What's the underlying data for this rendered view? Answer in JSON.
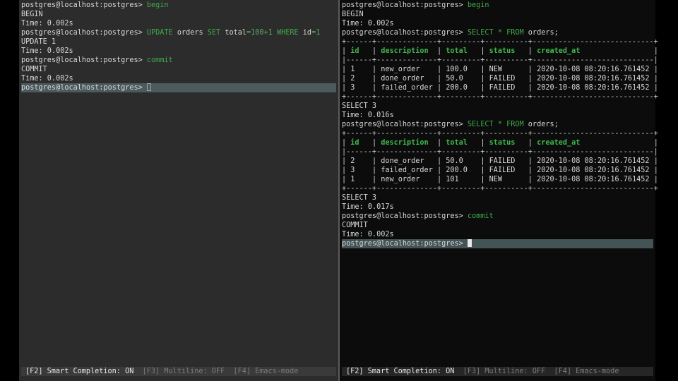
{
  "left": {
    "lines": [
      {
        "prompt": "postgres@localhost:postgres> ",
        "cmd": "begin"
      },
      {
        "out": "BEGIN"
      },
      {
        "out": "Time: 0.002s"
      },
      {
        "prompt": "postgres@localhost:postgres> ",
        "cmd": "UPDATE orders SET total=100+1 WHERE id=1"
      },
      {
        "out": "UPDATE 1"
      },
      {
        "out": "Time: 0.002s"
      },
      {
        "prompt": "postgres@localhost:postgres> ",
        "cmd": "commit"
      },
      {
        "out": "COMMIT"
      },
      {
        "out": "Time: 0.002s"
      },
      {
        "prompt": "postgres@localhost:postgres> ",
        "current": true
      }
    ],
    "toolbar": {
      "f2": "[F2] Smart Completion: ON",
      "f3": "[F3] Multiline: OFF",
      "f4": "[F4] Emacs-mode"
    }
  },
  "right": {
    "lines": [
      {
        "prompt": "postgres@localhost:postgres> ",
        "cmd": "begin"
      },
      {
        "out": "BEGIN"
      },
      {
        "out": "Time: 0.002s"
      },
      {
        "prompt": "postgres@localhost:postgres> ",
        "cmd": "SELECT * FROM orders;"
      },
      {
        "table": 1
      },
      {
        "out": "SELECT 3"
      },
      {
        "out": "Time: 0.016s"
      },
      {
        "prompt": "postgres@localhost:postgres> ",
        "cmd": "SELECT * FROM orders;"
      },
      {
        "table": 2
      },
      {
        "out": "SELECT 3"
      },
      {
        "out": "Time: 0.017s"
      },
      {
        "prompt": "postgres@localhost:postgres> ",
        "cmd": "commit"
      },
      {
        "out": "COMMIT"
      },
      {
        "out": "Time: 0.002s"
      },
      {
        "prompt": "postgres@localhost:postgres> ",
        "current": true
      }
    ],
    "tables": {
      "columns": [
        "id",
        "description",
        "total",
        "status",
        "created_at"
      ],
      "t1": [
        [
          "1",
          "new_order",
          "100.0",
          "NEW",
          "2020-10-08 08:20:16.761452"
        ],
        [
          "2",
          "done_order",
          "50.0",
          "FAILED",
          "2020-10-08 08:20:16.761452"
        ],
        [
          "3",
          "failed_order",
          "200.0",
          "FAILED",
          "2020-10-08 08:20:16.761452"
        ]
      ],
      "t2": [
        [
          "2",
          "done_order",
          "50.0",
          "FAILED",
          "2020-10-08 08:20:16.761452"
        ],
        [
          "3",
          "failed_order",
          "200.0",
          "FAILED",
          "2020-10-08 08:20:16.761452"
        ],
        [
          "1",
          "new_order",
          "101",
          "NEW",
          "2020-10-08 08:20:16.761452"
        ]
      ]
    },
    "toolbar": {
      "f2": "[F2] Smart Completion: ON",
      "f3": "[F3] Multiline: OFF",
      "f4": "[F4] Emacs-mode"
    }
  },
  "colors": {
    "keyword": "#3fa94b",
    "header": "#3fb94e",
    "left_bg": "#2c2c2c",
    "right_bg": "#0c0c0c"
  }
}
